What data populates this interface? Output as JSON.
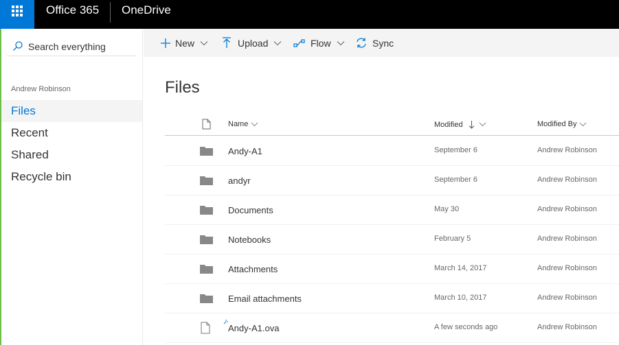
{
  "topbar": {
    "suite_title": "Office 365",
    "app_title": "OneDrive",
    "colors": {
      "bar": "#000000",
      "waffle": "#0078d7"
    }
  },
  "leftnav": {
    "search_label": "Search everything",
    "user_name": "Andrew Robinson",
    "items": [
      {
        "label": "Files",
        "selected": true
      },
      {
        "label": "Recent",
        "selected": false
      },
      {
        "label": "Shared",
        "selected": false
      },
      {
        "label": "Recycle bin",
        "selected": false
      }
    ]
  },
  "commandbar": {
    "new_label": "New",
    "upload_label": "Upload",
    "flow_label": "Flow",
    "sync_label": "Sync"
  },
  "main": {
    "title": "Files",
    "columns": {
      "name": "Name",
      "modified": "Modified",
      "modified_by": "Modified By"
    },
    "sort": {
      "column": "Modified",
      "direction": "descending"
    },
    "rows": [
      {
        "type": "folder",
        "name": "Andy-A1",
        "modified": "September 6",
        "modified_by": "Andrew Robinson"
      },
      {
        "type": "folder",
        "name": "andyr",
        "modified": "September 6",
        "modified_by": "Andrew Robinson"
      },
      {
        "type": "folder",
        "name": "Documents",
        "modified": "May 30",
        "modified_by": "Andrew Robinson"
      },
      {
        "type": "folder",
        "name": "Notebooks",
        "modified": "February 5",
        "modified_by": "Andrew Robinson"
      },
      {
        "type": "folder",
        "name": "Attachments",
        "modified": "March 14, 2017",
        "modified_by": "Andrew Robinson"
      },
      {
        "type": "folder",
        "name": "Email attachments",
        "modified": "March 10, 2017",
        "modified_by": "Andrew Robinson"
      },
      {
        "type": "file",
        "name": "Andy-A1.ova",
        "modified": "A few seconds ago",
        "modified_by": "Andrew Robinson",
        "new": true
      }
    ]
  },
  "colors": {
    "accent": "#0078d7",
    "nav_edge": "#6dbd46",
    "folder": "#8a8886"
  },
  "icons": [
    "waffle-icon",
    "search-icon",
    "plus-icon",
    "upload-icon",
    "flow-icon",
    "sync-icon",
    "file-type-icon",
    "folder-icon",
    "file-icon",
    "sort-down-icon",
    "chevron-down-icon",
    "new-item-sparkle-icon"
  ]
}
